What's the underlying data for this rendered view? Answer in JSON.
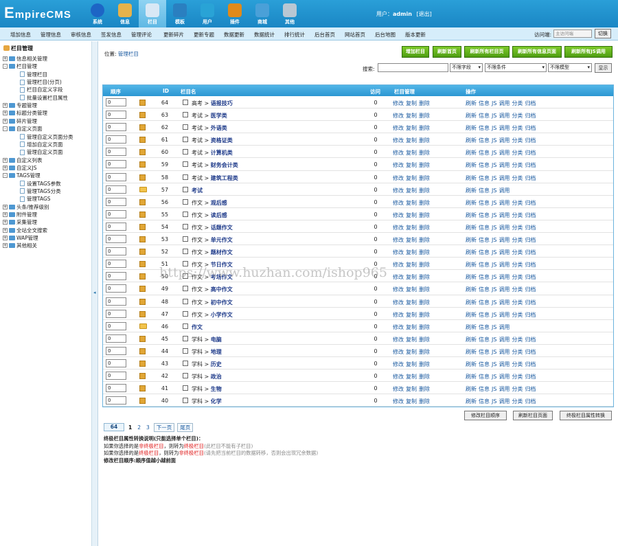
{
  "header": {
    "logo_main": "E",
    "logo_rest": "mpireCMS",
    "nav": [
      {
        "label": "系统",
        "icon": "globe-icon",
        "color": "#1d65c5"
      },
      {
        "label": "信息",
        "icon": "edit-icon",
        "color": "#e6b24a"
      },
      {
        "label": "栏目",
        "icon": "folder-icon",
        "color": "#d9e8f5"
      },
      {
        "label": "模板",
        "icon": "template-icon",
        "color": "#2a7fc0"
      },
      {
        "label": "用户",
        "icon": "user-icon",
        "color": "#29a3d6"
      },
      {
        "label": "插件",
        "icon": "plugin-icon",
        "color": "#e08a1a"
      },
      {
        "label": "商城",
        "icon": "shop-icon",
        "color": "#4aa0d8"
      },
      {
        "label": "其他",
        "icon": "gear-icon",
        "color": "#b9c7d3"
      }
    ],
    "user_prefix": "用户：",
    "username": "admin",
    "logout": "[退出]"
  },
  "menubar": {
    "items": [
      "增加信息",
      "管理信息",
      "审核信息",
      "签发信息",
      "管理评论",
      "更新碎片",
      "更新专题",
      "数据更新",
      "数据统计",
      "排行统计",
      "后台首页",
      "网站首页",
      "后台地图",
      "版本更新"
    ],
    "visit_label": "访问端:",
    "visit_value": "主访问端",
    "switch_label": "切换"
  },
  "sidebar": {
    "title": "栏目管理",
    "items": [
      {
        "label": "信息相关管理",
        "level": 0,
        "kind": "folder",
        "pm": "+"
      },
      {
        "label": "栏目管理",
        "level": 0,
        "kind": "folder",
        "pm": "-"
      },
      {
        "label": "管理栏目",
        "level": 1,
        "kind": "doc"
      },
      {
        "label": "管理栏目(分页)",
        "level": 1,
        "kind": "doc"
      },
      {
        "label": "栏目自定义字段",
        "level": 1,
        "kind": "doc"
      },
      {
        "label": "批量设置栏目属性",
        "level": 1,
        "kind": "doc"
      },
      {
        "label": "专题管理",
        "level": 0,
        "kind": "folder",
        "pm": "+"
      },
      {
        "label": "标题分类管理",
        "level": 0,
        "kind": "folder",
        "pm": "+"
      },
      {
        "label": "碎片管理",
        "level": 0,
        "kind": "folder",
        "pm": "+"
      },
      {
        "label": "自定义页面",
        "level": 0,
        "kind": "folder",
        "pm": "-"
      },
      {
        "label": "管理自定义页面分类",
        "level": 1,
        "kind": "doc"
      },
      {
        "label": "增加自定义页面",
        "level": 1,
        "kind": "doc"
      },
      {
        "label": "管理自定义页面",
        "level": 1,
        "kind": "doc"
      },
      {
        "label": "自定义列表",
        "level": 0,
        "kind": "folder",
        "pm": "+"
      },
      {
        "label": "自定义JS",
        "level": 0,
        "kind": "folder",
        "pm": "+"
      },
      {
        "label": "TAGS管理",
        "level": 0,
        "kind": "folder",
        "pm": "-"
      },
      {
        "label": "设置TAGS参数",
        "level": 1,
        "kind": "doc"
      },
      {
        "label": "管理TAGS分类",
        "level": 1,
        "kind": "doc"
      },
      {
        "label": "管理TAGS",
        "level": 1,
        "kind": "doc"
      },
      {
        "label": "头条/推荐级别",
        "level": 0,
        "kind": "folder",
        "pm": "+"
      },
      {
        "label": "附件管理",
        "level": 0,
        "kind": "folder",
        "pm": "+"
      },
      {
        "label": "采集管理",
        "level": 0,
        "kind": "folder",
        "pm": "+"
      },
      {
        "label": "全站全文搜索",
        "level": 0,
        "kind": "folder",
        "pm": "+"
      },
      {
        "label": "WAP管理",
        "level": 0,
        "kind": "folder",
        "pm": "+"
      },
      {
        "label": "其他相关",
        "level": 0,
        "kind": "folder",
        "pm": "+"
      }
    ]
  },
  "content": {
    "position_label": "位置: ",
    "position_link": "管理栏目",
    "buttons": [
      "增加栏目",
      "刷新首页",
      "刷新所有栏目页",
      "刷新所有信息页面",
      "刷新所有JS调用"
    ],
    "search_label": "搜索:",
    "search_value": "",
    "selects": [
      "不限字段",
      "不限条件",
      "不限模型"
    ],
    "show_label": "显示",
    "table": {
      "headers": {
        "order": "顺序",
        "id": "ID",
        "name": "栏目名",
        "visits": "访问",
        "manage": "栏目管理",
        "ops": "操作"
      },
      "manage_links": [
        "修改",
        "复制",
        "删除"
      ],
      "ops_links": [
        "刷新",
        "信息",
        "JS",
        "调用",
        "分类",
        "归档"
      ],
      "ops_links_short": [
        "刷新",
        "信息",
        "JS",
        "调用"
      ],
      "rows": [
        {
          "order": "0",
          "id": "64",
          "parent": "高考",
          "name": "语报技巧",
          "visits": "0",
          "folder": false
        },
        {
          "order": "0",
          "id": "63",
          "parent": "考试",
          "name": "医学类",
          "visits": "0",
          "folder": false
        },
        {
          "order": "0",
          "id": "62",
          "parent": "考试",
          "name": "外语类",
          "visits": "0",
          "folder": false
        },
        {
          "order": "0",
          "id": "61",
          "parent": "考试",
          "name": "资格证类",
          "visits": "0",
          "folder": false
        },
        {
          "order": "0",
          "id": "60",
          "parent": "考试",
          "name": "计算机类",
          "visits": "0",
          "folder": false
        },
        {
          "order": "0",
          "id": "59",
          "parent": "考试",
          "name": "财务会计类",
          "visits": "0",
          "folder": false
        },
        {
          "order": "0",
          "id": "58",
          "parent": "考试",
          "name": "建筑工程类",
          "visits": "0",
          "folder": false
        },
        {
          "order": "0",
          "id": "57",
          "parent": "",
          "name": "考试",
          "visits": "0",
          "folder": true
        },
        {
          "order": "0",
          "id": "56",
          "parent": "作文",
          "name": "观后感",
          "visits": "0",
          "folder": false
        },
        {
          "order": "0",
          "id": "55",
          "parent": "作文",
          "name": "读后感",
          "visits": "0",
          "folder": false
        },
        {
          "order": "0",
          "id": "54",
          "parent": "作文",
          "name": "话题作文",
          "visits": "0",
          "folder": false
        },
        {
          "order": "0",
          "id": "53",
          "parent": "作文",
          "name": "单元作文",
          "visits": "0",
          "folder": false
        },
        {
          "order": "0",
          "id": "52",
          "parent": "作文",
          "name": "题材作文",
          "visits": "0",
          "folder": false
        },
        {
          "order": "0",
          "id": "51",
          "parent": "作文",
          "name": "节日作文",
          "visits": "0",
          "folder": false
        },
        {
          "order": "0",
          "id": "50",
          "parent": "作文",
          "name": "考场作文",
          "visits": "0",
          "folder": false
        },
        {
          "order": "0",
          "id": "49",
          "parent": "作文",
          "name": "高中作文",
          "visits": "0",
          "folder": false
        },
        {
          "order": "0",
          "id": "48",
          "parent": "作文",
          "name": "初中作文",
          "visits": "0",
          "folder": false
        },
        {
          "order": "0",
          "id": "47",
          "parent": "作文",
          "name": "小学作文",
          "visits": "0",
          "folder": false
        },
        {
          "order": "0",
          "id": "46",
          "parent": "",
          "name": "作文",
          "visits": "0",
          "folder": true
        },
        {
          "order": "0",
          "id": "45",
          "parent": "学科",
          "name": "电脑",
          "visits": "0",
          "folder": false
        },
        {
          "order": "0",
          "id": "44",
          "parent": "学科",
          "name": "地理",
          "visits": "0",
          "folder": false
        },
        {
          "order": "0",
          "id": "43",
          "parent": "学科",
          "name": "历史",
          "visits": "0",
          "folder": false
        },
        {
          "order": "0",
          "id": "42",
          "parent": "学科",
          "name": "政治",
          "visits": "0",
          "folder": false
        },
        {
          "order": "0",
          "id": "41",
          "parent": "学科",
          "name": "生物",
          "visits": "0",
          "folder": false
        },
        {
          "order": "0",
          "id": "40",
          "parent": "学科",
          "name": "化学",
          "visits": "0",
          "folder": false
        }
      ]
    },
    "bottom_buttons": [
      "修改栏目顺序",
      "刷新栏目页面",
      "终极栏目属性转换"
    ],
    "pager": {
      "total": "64",
      "pages": [
        "1",
        "2",
        "3"
      ],
      "current": "1",
      "next": "下一页",
      "last": "尾页"
    },
    "notes": {
      "title": "终极栏目属性转换说明(只能选择单个栏目)：",
      "line1_a": "如果你选择的是",
      "line1_red1": "非终极栏目",
      "line1_b": "，则转为",
      "line1_red2": "终极栏目",
      "line1_gray": "(此栏目不能有子栏目)",
      "line2_a": "如果你选择的是",
      "line2_red1": "终极栏目",
      "line2_b": "，则转为",
      "line2_red2": "非终极栏目",
      "line2_gray": "(请先把当前栏目的数据转移，否则会出现冗余数据)",
      "order_note": "修改栏目顺序:顺序值越小越前面"
    },
    "watermark": "https://www.huzhan.com/ishop965"
  }
}
